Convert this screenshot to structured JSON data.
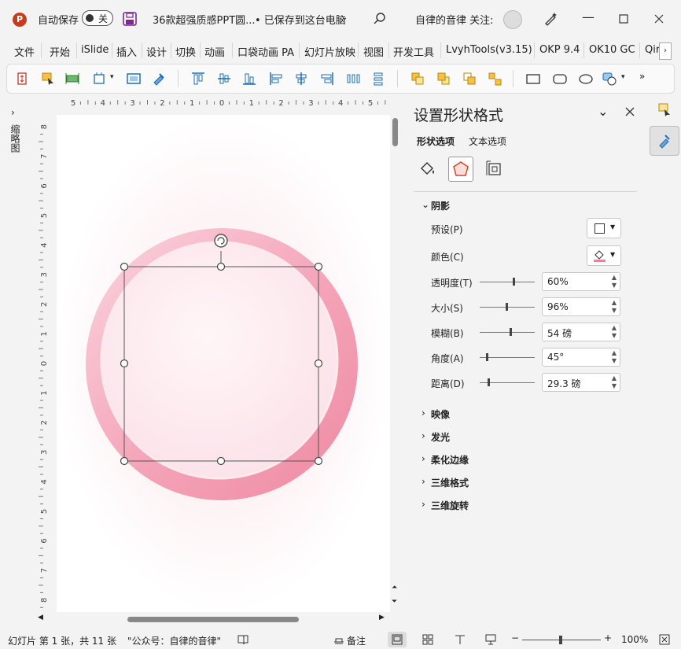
{
  "titlebar": {
    "autosave_label": "自动保存",
    "autosave_state": "关",
    "doc_title": "36款超强质感PPT圆...",
    "save_status": "• 已保存到这台电脑",
    "user_info": "自律的音律 关注:",
    "app_icon_letter": "P"
  },
  "menu": {
    "items": [
      "文件",
      "开始",
      "iSlide",
      "插入",
      "设计",
      "切换",
      "动画",
      "口袋动画 PA",
      "幻灯片放映",
      "视图",
      "开发工具",
      "LvyhTools(v3.15)",
      "OKP 9.4",
      "OK10 GC",
      "Qir"
    ]
  },
  "thumbs": {
    "label": "缩略图"
  },
  "ruler": {
    "h_ticks": [
      "5",
      "4",
      "3",
      "2",
      "1",
      "0",
      "1",
      "2",
      "3",
      "4",
      "5"
    ],
    "v_ticks": [
      "8",
      "7",
      "6",
      "5",
      "4",
      "3",
      "2",
      "1",
      "0",
      "1",
      "2",
      "3",
      "4",
      "5",
      "6",
      "7",
      "8"
    ]
  },
  "pane": {
    "title": "设置形状格式",
    "tab_shape": "形状选项",
    "tab_text": "文本选项",
    "shadow_section": "阴影",
    "preset_label": "预设(P)",
    "color_label": "颜色(C)",
    "transparency_label": "透明度(T)",
    "transparency_value": "60%",
    "size_label": "大小(S)",
    "size_value": "96%",
    "blur_label": "模糊(B)",
    "blur_value": "54 磅",
    "angle_label": "角度(A)",
    "angle_value": "45°",
    "distance_label": "距离(D)",
    "distance_value": "29.3 磅",
    "collapsed_sections": [
      "映像",
      "发光",
      "柔化边缘",
      "三维格式",
      "三维旋转"
    ],
    "color_swatch": "#e8859b"
  },
  "status": {
    "slide_info": "幻灯片 第 1 张，共 11 张",
    "notes_text": "\"公众号：自律的音律\"",
    "notes_label": "备注",
    "zoom": "100%"
  },
  "colors": {
    "ring_pink": "#f4a3b8",
    "ring_inner": "#fbe3ea",
    "accent": "#c43e1c"
  }
}
